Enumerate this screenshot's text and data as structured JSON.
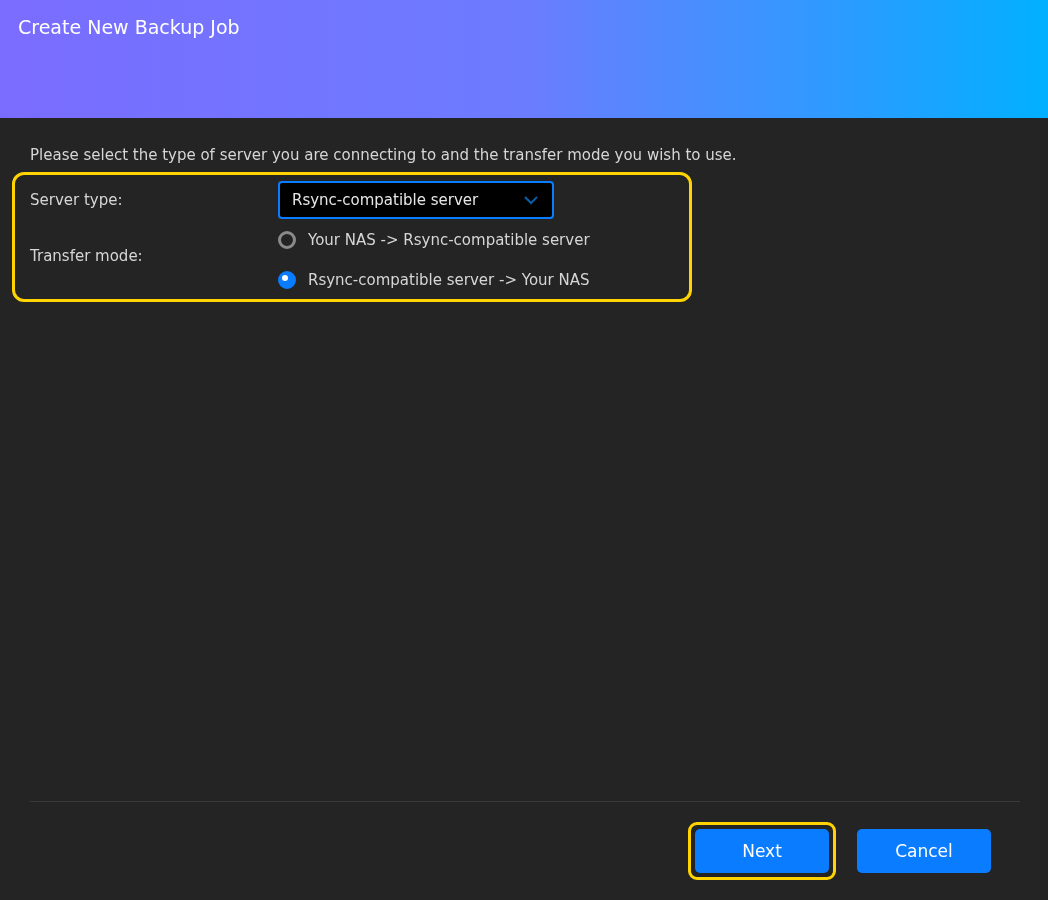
{
  "window": {
    "title": "Create New Backup Job"
  },
  "description": "Please select the type of server you are connecting to and the transfer mode you wish to use.",
  "form": {
    "highlighted": true,
    "server_type": {
      "label": "Server type:",
      "value": "Rsync-compatible server"
    },
    "transfer_mode": {
      "label": "Transfer mode:",
      "options": [
        {
          "label": "Your NAS -> Rsync-compatible server",
          "selected": false
        },
        {
          "label": "Rsync-compatible server -> Your NAS",
          "selected": true
        }
      ]
    }
  },
  "buttons": [
    {
      "label": "Next",
      "highlighted": true
    },
    {
      "label": "Cancel",
      "highlighted": false
    }
  ]
}
